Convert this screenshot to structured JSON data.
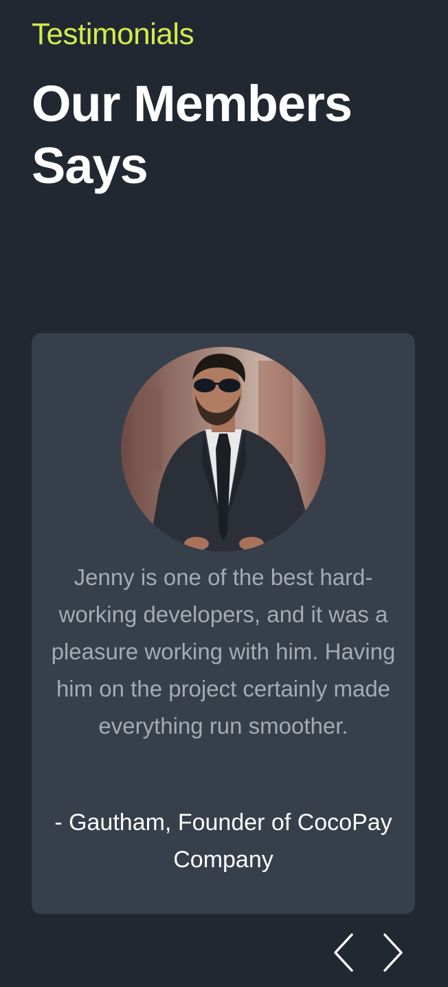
{
  "section": {
    "eyebrow": "Testimonials",
    "headline": "Our Members Says"
  },
  "testimonial": {
    "avatar_icon": "person-photo",
    "quote": "Jenny is one of the best hard-working developers, and it was a pleasure working with him. Having him on the project certainly made everything run smoother.",
    "author": "- Gautham, Founder of CocoPay Company"
  },
  "carousel": {
    "prev_icon": "chevron-left-icon",
    "next_icon": "chevron-right-icon"
  },
  "colors": {
    "background": "#222831",
    "card": "#363f4a",
    "accent": "#d4ec4d",
    "quote_text": "#a4abb3",
    "heading_text": "#ffffff"
  }
}
